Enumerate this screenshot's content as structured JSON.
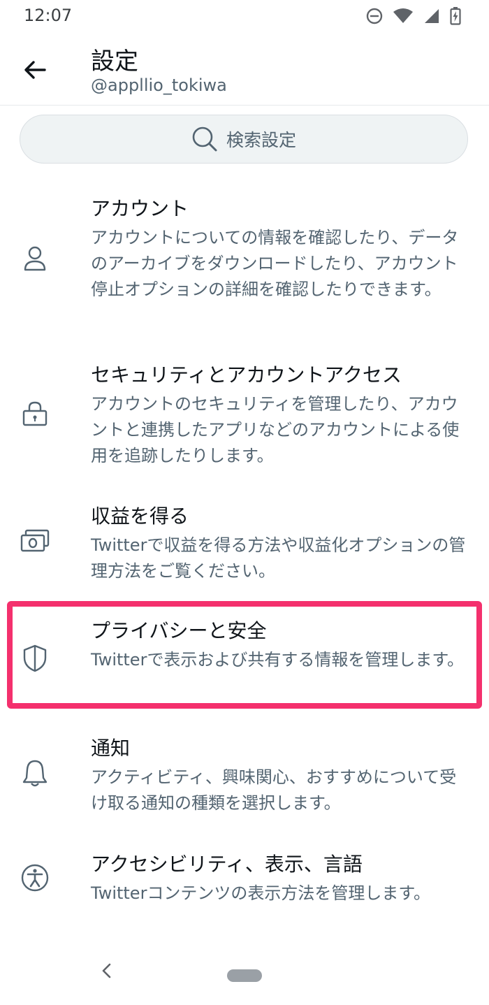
{
  "status": {
    "time": "12:07"
  },
  "header": {
    "title": "設定",
    "username": "@appllio_tokiwa"
  },
  "search": {
    "placeholder": "検索設定"
  },
  "items": [
    {
      "title": "アカウント",
      "description": "アカウントについての情報を確認したり、データのアーカイブをダウンロードしたり、アカウント停止オプションの詳細を確認したりできます。",
      "icon": "person-icon"
    },
    {
      "title": "セキュリティとアカウントアクセス",
      "description": "アカウントのセキュリティを管理したり、アカウントと連携したアプリなどのアカウントによる使用を追跡したりします。",
      "icon": "lock-icon"
    },
    {
      "title": "収益を得る",
      "description": "Twitterで収益を得る方法や収益化オプションの管理方法をご覧ください。",
      "icon": "money-icon"
    },
    {
      "title": "プライバシーと安全",
      "description": "Twitterで表示および共有する情報を管理します。",
      "icon": "shield-icon"
    },
    {
      "title": "通知",
      "description": "アクティビティ、興味関心、おすすめについて受け取る通知の種類を選択します。",
      "icon": "bell-icon"
    },
    {
      "title": "アクセシビリティ、表示、言語",
      "description": "Twitterコンテンツの表示方法を管理します。",
      "icon": "accessibility-icon"
    }
  ],
  "colors": {
    "highlight": "#f4306d",
    "secondary_text": "#536471"
  }
}
